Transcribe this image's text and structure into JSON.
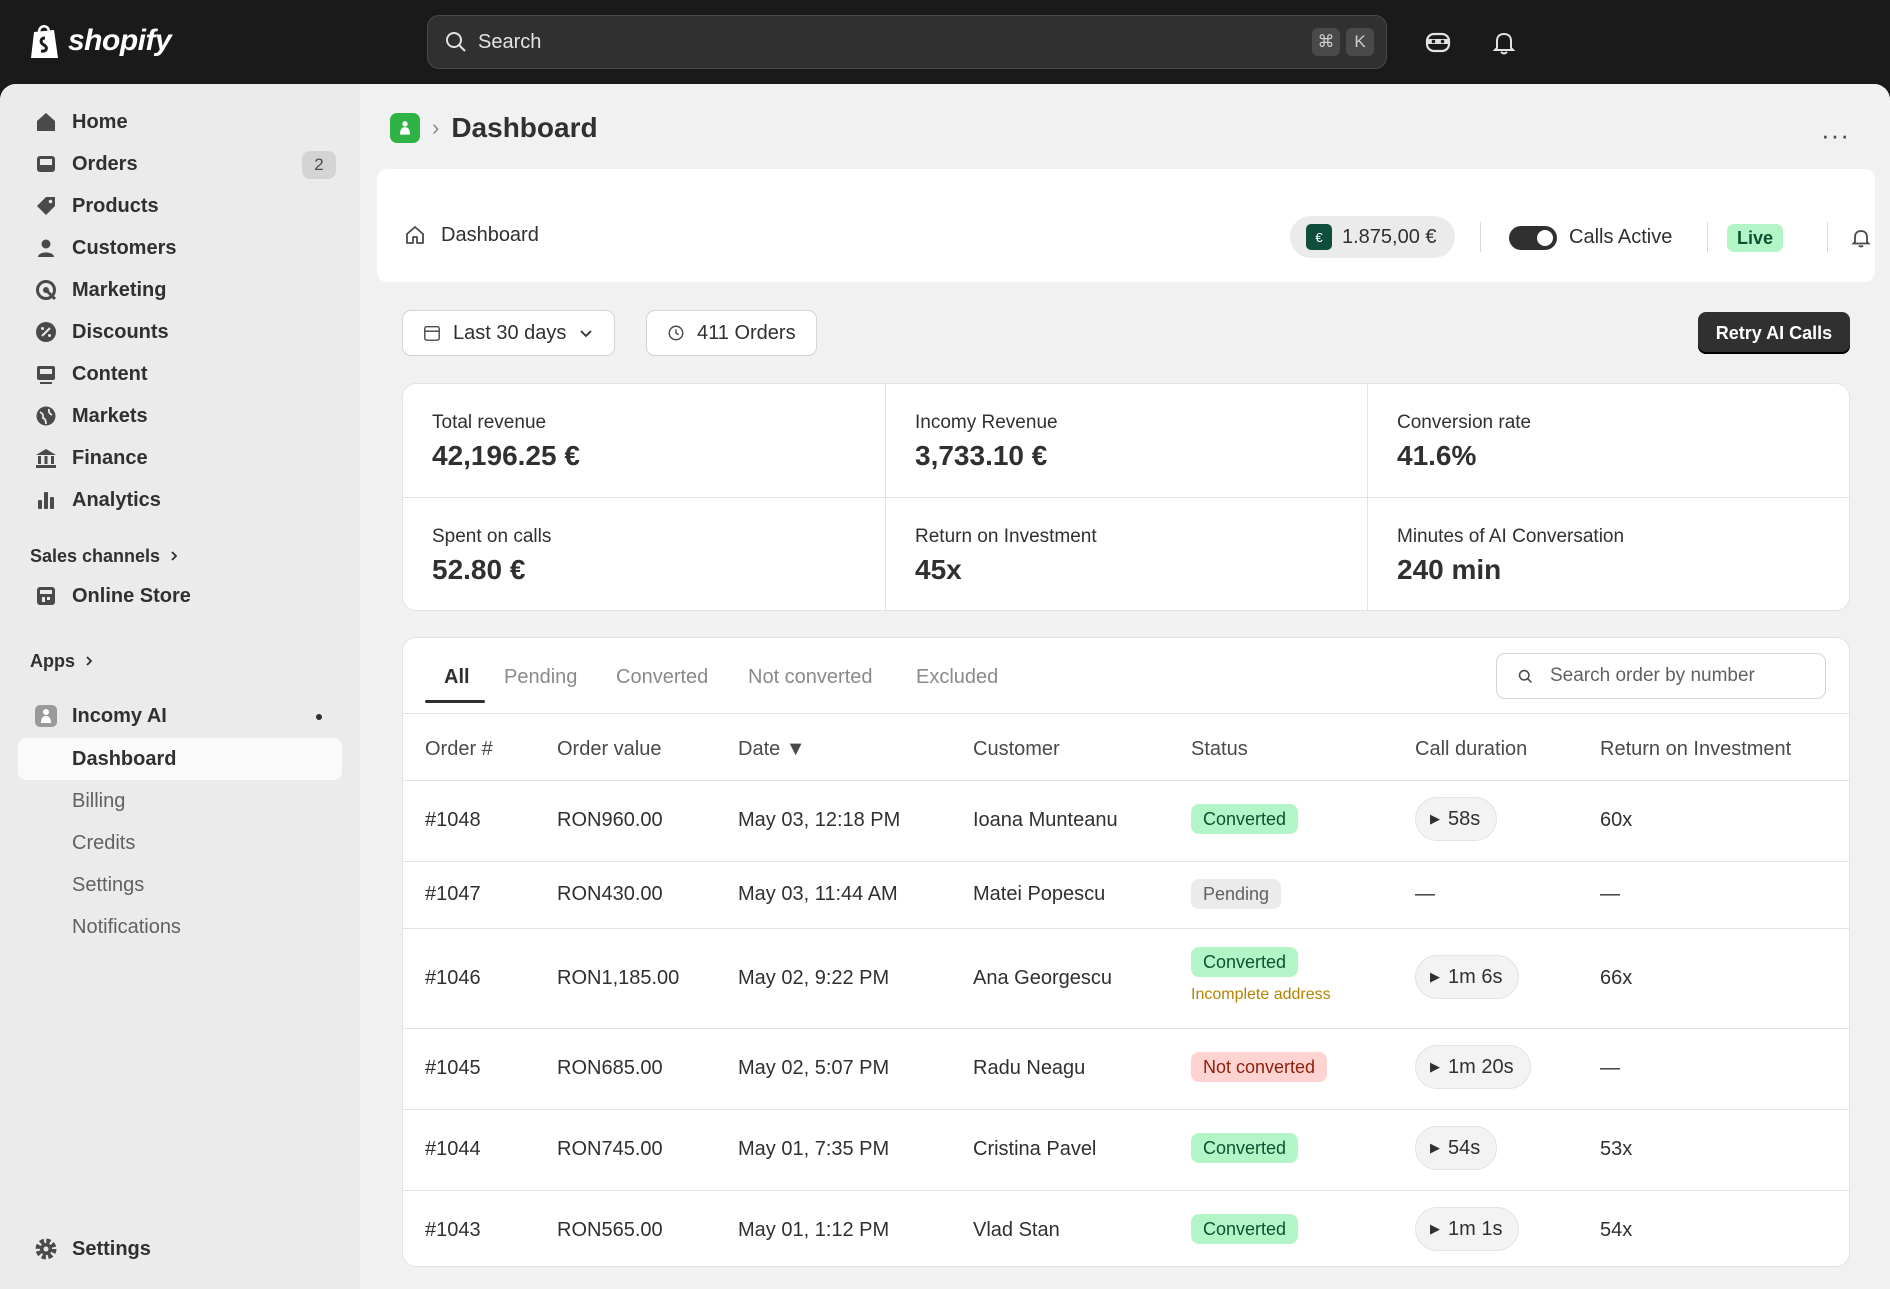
{
  "topbar": {
    "logo_text": "shopify",
    "search_placeholder": "Search",
    "shortcut_cmd": "⌘",
    "shortcut_key": "K"
  },
  "sidebar": {
    "items": [
      {
        "label": "Home",
        "icon": "home-icon"
      },
      {
        "label": "Orders",
        "icon": "orders-icon",
        "badge": "2"
      },
      {
        "label": "Products",
        "icon": "tag-icon"
      },
      {
        "label": "Customers",
        "icon": "person-icon"
      },
      {
        "label": "Marketing",
        "icon": "target-icon"
      },
      {
        "label": "Discounts",
        "icon": "discount-icon"
      },
      {
        "label": "Content",
        "icon": "content-icon"
      },
      {
        "label": "Markets",
        "icon": "globe-icon"
      },
      {
        "label": "Finance",
        "icon": "bank-icon"
      },
      {
        "label": "Analytics",
        "icon": "bar-chart-icon"
      }
    ],
    "sales_channels_label": "Sales channels",
    "online_store_label": "Online Store",
    "apps_label": "Apps",
    "app_name": "Incomy AI",
    "app_subitems": [
      "Dashboard",
      "Billing",
      "Credits",
      "Settings",
      "Notifications"
    ],
    "settings_label": "Settings"
  },
  "page": {
    "title": "Dashboard",
    "more_label": "···"
  },
  "header_card": {
    "label": "Dashboard",
    "balance": "1.875,00 €",
    "calls_label": "Calls Active",
    "live_badge": "Live"
  },
  "filters": {
    "date_range": "Last 30 days",
    "orders_count": "411 Orders",
    "retry_button": "Retry AI Calls"
  },
  "metrics": [
    {
      "label": "Total revenue",
      "value": "42,196.25 €"
    },
    {
      "label": "Incomy Revenue",
      "value": "3,733.10 €"
    },
    {
      "label": "Conversion rate",
      "value": "41.6%"
    },
    {
      "label": "Spent on calls",
      "value": "52.80 €"
    },
    {
      "label": "Return on Investment",
      "value": "45x"
    },
    {
      "label": "Minutes of AI Conversation",
      "value": "240 min"
    }
  ],
  "table": {
    "tabs": [
      "All",
      "Pending",
      "Converted",
      "Not converted",
      "Excluded"
    ],
    "search_placeholder": "Search order by number",
    "columns": [
      "Order #",
      "Order value",
      "Date ▼",
      "Customer",
      "Status",
      "Call duration",
      "Return on Investment"
    ],
    "rows": [
      {
        "order": "#1048",
        "value": "RON960.00",
        "date": "May 03, 12:18 PM",
        "customer": "Ioana Munteanu",
        "status": "Converted",
        "status_kind": "green",
        "note": "",
        "duration": "58s",
        "roi": "60x"
      },
      {
        "order": "#1047",
        "value": "RON430.00",
        "date": "May 03, 11:44 AM",
        "customer": "Matei Popescu",
        "status": "Pending",
        "status_kind": "gray",
        "note": "",
        "duration": "—",
        "roi": "—"
      },
      {
        "order": "#1046",
        "value": "RON1,185.00",
        "date": "May 02, 9:22 PM",
        "customer": "Ana Georgescu",
        "status": "Converted",
        "status_kind": "green",
        "note": "Incomplete address",
        "duration": "1m 6s",
        "roi": "66x"
      },
      {
        "order": "#1045",
        "value": "RON685.00",
        "date": "May 02, 5:07 PM",
        "customer": "Radu Neagu",
        "status": "Not converted",
        "status_kind": "red",
        "note": "",
        "duration": "1m 20s",
        "roi": "—"
      },
      {
        "order": "#1044",
        "value": "RON745.00",
        "date": "May 01, 7:35 PM",
        "customer": "Cristina Pavel",
        "status": "Converted",
        "status_kind": "green",
        "note": "",
        "duration": "54s",
        "roi": "53x"
      },
      {
        "order": "#1043",
        "value": "RON565.00",
        "date": "May 01, 1:12 PM",
        "customer": "Vlad Stan",
        "status": "Converted",
        "status_kind": "green",
        "note": "",
        "duration": "1m 1s",
        "roi": "54x"
      }
    ]
  }
}
